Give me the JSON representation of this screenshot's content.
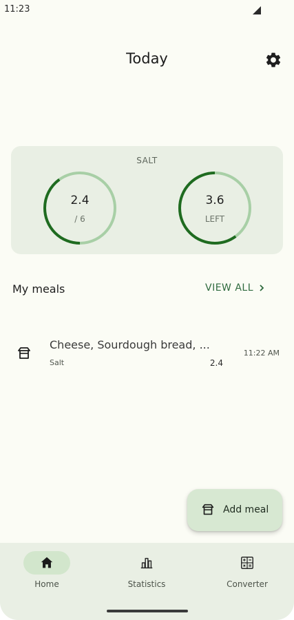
{
  "status_bar": {
    "time": "11:23",
    "signal_icon": "signal-icon"
  },
  "header": {
    "title": "Today",
    "settings_icon": "gear-icon"
  },
  "salt_card": {
    "title": "SALT",
    "consumed": {
      "value": "2.4",
      "sub": "/ 6",
      "progress": 0.4
    },
    "left": {
      "value": "3.6",
      "sub": "LEFT",
      "progress": 0.6
    }
  },
  "meals_section": {
    "title": "My meals",
    "view_all": "VIEW ALL"
  },
  "meals": [
    {
      "name": "Cheese, Sourdough bread, ...",
      "nutrient": "Salt",
      "amount": "2.4",
      "time": "11:22 AM",
      "icon": "meal-bowl-icon"
    }
  ],
  "fab": {
    "label": "Add meal",
    "icon": "meal-bowl-icon"
  },
  "nav": {
    "items": [
      {
        "label": "Home",
        "icon": "home-icon",
        "active": true
      },
      {
        "label": "Statistics",
        "icon": "statistics-icon",
        "active": false
      },
      {
        "label": "Converter",
        "icon": "converter-icon",
        "active": false
      }
    ]
  },
  "colors": {
    "background": "#fbfcf5",
    "card": "#e9efe4",
    "ring_track": "#a8cfa6",
    "ring_progress": "#1f6b20",
    "accent": "#2f6a3e",
    "fab": "#d7e8d2",
    "nav_active": "#d2e6cc"
  }
}
